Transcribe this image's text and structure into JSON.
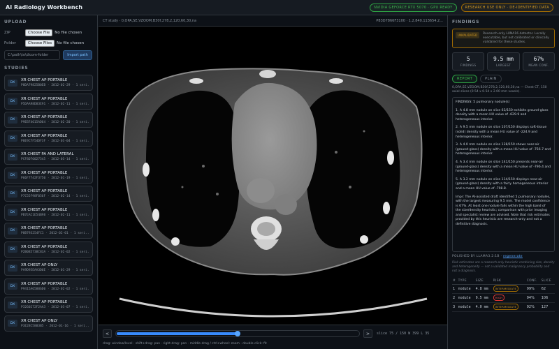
{
  "header": {
    "title": "AI Radiology Workbench",
    "gpu_badge": "NVIDIA GEFORCE RTX 5070 · GPU READY",
    "research_badge": "RESEARCH USE ONLY · DE-IDENTIFIED DATA"
  },
  "upload": {
    "section_title": "UPLOAD",
    "zip_label": "ZIP",
    "folder_label": "Folder",
    "choose_file_label": "Choose File",
    "choose_files_label": "Choose Files",
    "no_file_text": "No file chosen",
    "path_placeholder": "C:\\path\\to\\dicom-folder",
    "import_button": "Import path"
  },
  "studies": {
    "section_title": "STUDIES",
    "items": [
      {
        "tag": "DX",
        "name": "XR CHEST AP PORTABLE",
        "sub": "P8DA79825B0EB · 2012-02-29 · 1 seri..."
      },
      {
        "tag": "DX",
        "name": "XR CHEST AP PORTABLE",
        "sub": "P5DAA98D83E91 · 2012-02-11 · 1 seri..."
      },
      {
        "tag": "DX",
        "name": "XR CHEST AP PORTABLE",
        "sub": "P9EB74615AD64 · 2012-02-20 · 1 seri..."
      },
      {
        "tag": "DX",
        "name": "XR CHEST AP PORTABLE",
        "sub": "P8E9C7F54DF3F · 2012-03-04 · 1 seri..."
      },
      {
        "tag": "DX",
        "name": "XR CHEST PA AND LATERAL",
        "sub": "PCF8D76027545 · 2012-03-14 · 1 seri..."
      },
      {
        "tag": "DX",
        "name": "XR CHEST AP PORTABLE",
        "sub": "P66F7742F3750 · 2012-01-19 · 1 seri..."
      },
      {
        "tag": "DX",
        "name": "XR CHEST AP PORTABLE",
        "sub": "P7C55F98F056F · 2012-02-14 · 1 seri..."
      },
      {
        "tag": "DX",
        "name": "XR CHEST AP PORTABLE",
        "sub": "PB7EAC1E54B98 · 2012-02-11 · 1 seri..."
      },
      {
        "tag": "DX",
        "name": "XR CHEST AP PORTABLE",
        "sub": "P8B793254FC1 · 2012-02-01 · 1 seri..."
      },
      {
        "tag": "DX",
        "name": "XR CHEST AP PORTABLE",
        "sub": "P2B085738C83A · 2012-02-02 · 1 seri..."
      },
      {
        "tag": "DX",
        "name": "XR CHEST AP ONLY",
        "sub": "PA9D95EAA3D6E · 2012-01-29 · 1 seri..."
      },
      {
        "tag": "DX",
        "name": "XR CHEST AP PORTABLE",
        "sub": "P9415A65886D0 · 2012-02-02 · 1 seri..."
      },
      {
        "tag": "DX",
        "name": "XR CHEST AP PORTABLE",
        "sub": "P3260272F2AA3 · 2012-03-07 · 1 seri..."
      },
      {
        "tag": "DX",
        "name": "XR CHEST AP ONLY",
        "sub": "P3E28C5883B5 · 2012-01-16 · 1 seri..."
      }
    ]
  },
  "viewer": {
    "study_label": "CT study · 0,OPA,SE,VZOOM,B30f,278,2,120,60,30,na",
    "uid": "P83D7866F3100 · 1.2.840.113654.2...",
    "prev_button": "<",
    "next_button": ">",
    "slice_info": "slice 75 / 150  W 399  L 35",
    "slice_current": 75,
    "slice_total": 150,
    "hint": "drag: window/level · shift+drag: pan · right-drag: pan · middle-drag / ctrl+wheel: zoom · double-click: fit"
  },
  "findings": {
    "section_title": "FINDINGS",
    "warning_chip": "UNVALIDATED",
    "warning_text": "Research-only LUNA16 detector. Locally executable, but not calibrated or clinically validated for these studies.",
    "stats": [
      {
        "value": "5",
        "label": "FINDINGS"
      },
      {
        "value": "9.5 mm",
        "label": "LARGEST"
      },
      {
        "value": "67%",
        "label": "MEAN CONF."
      }
    ],
    "tabs": [
      "REPORT",
      "PLAIN"
    ],
    "active_tab": "REPORT",
    "study_meta": "0,OPA,SE,VZOOM,B30f,278,2,120,60,30,na — Chest CT, 150 axial slices (0.54 x 0.54 x 2.00 mm voxels).",
    "report_paragraphs": [
      "FINDINGS: 5 pulmonary nodule(s)",
      "1. A 4.8 mm nodule on slice 63/150 exhibits ground-glass density with a mean HU value of -629.9 and heterogeneous interior.",
      "2. A 9.5 mm nodule on slice 107/150 displays soft-tissue (solid) density with a mean HU value of -224.9 and heterogeneous interior.",
      "3. A 4.0 mm nodule on slice 128/150 shows near-air (ground-glass) density with a mean HU value of -756.7 and heterogeneous interior.",
      "4. A 3.4 mm nodule on slice 141/150 presents near-air (ground-glass) density with a mean HU value of -796.4 and heterogeneous interior.",
      "5. A 3.2 mm nodule on slice 114/150 displays near-air (ground-glass) density with a fairly homogeneous interior and a mean HU value of -798.8.",
      "Impr: The AI-assisted draft identified 5 pulmonary nodules, with the largest measuring 9.5 mm. The model confidence is 67%. At least one nodule falls within the high band of the size/density heuristic; comparison with prior imaging and specialist review are advised. Note that risk estimates provided by this heuristic are research-only and not a definitive diagnosis."
    ],
    "polished_prefix": "POLISHED BY LLAMA3.2:1B ·",
    "polished_model": "regenerate",
    "risk_note": "Risk estimates are a research-only heuristic combining size, density and heterogeneity — not a validated malignancy probability and not a diagnosis.",
    "table": {
      "headers": [
        "#",
        "TYPE",
        "SIZE",
        "RISK",
        "CONF.",
        "SLICE"
      ],
      "rows": [
        {
          "n": "1",
          "type": "nodule",
          "size": "4.8 mm",
          "risk": "INTERMEDIATE",
          "risk_level": "intermediate",
          "conf": "99%",
          "slice": "62"
        },
        {
          "n": "2",
          "type": "nodule",
          "size": "9.5 mm",
          "risk": "HIGH",
          "risk_level": "high",
          "conf": "94%",
          "slice": "106"
        },
        {
          "n": "3",
          "type": "nodule",
          "size": "4.0 mm",
          "risk": "INTERMEDIATE",
          "risk_level": "intermediate",
          "conf": "92%",
          "slice": "127"
        }
      ]
    }
  },
  "colors": {
    "accent": "#388bfd",
    "success": "#3fb950",
    "warning": "#d29922",
    "danger": "#f85149"
  }
}
